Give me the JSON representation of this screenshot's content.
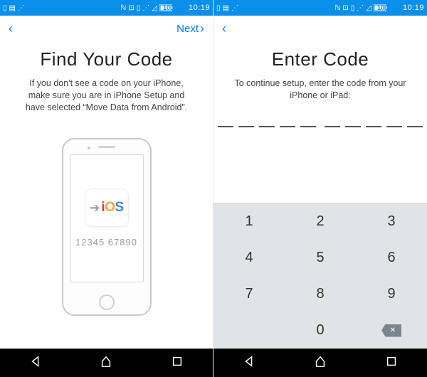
{
  "status": {
    "time": "10:19",
    "battery": "100"
  },
  "left": {
    "next_label": "Next",
    "title": "Find Your Code",
    "description": "If you don't see a code on your iPhone, make sure you are in iPhone Setup and have selected “Move Data from Android”.",
    "phone_code": "12345 67890",
    "ios_label": "iOS"
  },
  "right": {
    "title": "Enter Code",
    "description": "To continue setup, enter the code from your iPhone or iPad:"
  },
  "keypad": {
    "k1": "1",
    "k2": "2",
    "k3": "3",
    "k4": "4",
    "k5": "5",
    "k6": "6",
    "k7": "7",
    "k8": "8",
    "k9": "9",
    "k0": "0"
  }
}
